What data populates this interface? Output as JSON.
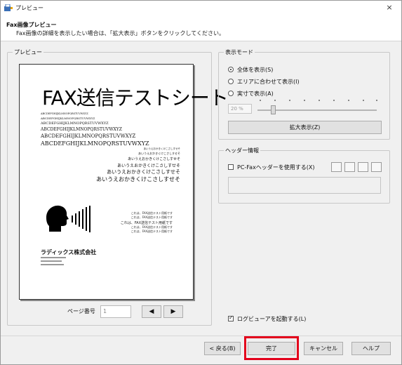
{
  "window": {
    "title": "プレビュー",
    "close_glyph": "×"
  },
  "header": {
    "title": "Fax画像プレビュー",
    "description": "Fax画像の詳細を表示したい場合は、「拡大表示」ボタンをクリックしてください。"
  },
  "preview": {
    "group_label": "プレビュー",
    "page_label": "ページ番号",
    "page_value": "1",
    "prev_glyph": "◀",
    "next_glyph": "▶",
    "document": {
      "title": "FAX送信テストシート",
      "alpha_lines": [
        "ABCDEFGHIJKLMNOPQRSTUVWXYZ",
        "ABCDEFGHIJKLMNOPQRSTUVWXYZ",
        "ABCDEFGHIJKLMNOPQRSTUVWXYZ",
        "ABCDEFGHIJKLMNOPQRSTUVWXYZ",
        "ABCDEFGHIJKLMNOPQRSTUVWXYZ",
        "ABCDEFGHIJKLMNOPQRSTUVWXYZ"
      ],
      "kana_lines": [
        "あいうえおかきくけこさしすせそ",
        "あいうえおかきくけこさしすせそ",
        "あいうえおかきくけこさしすせそ",
        "あいうえおかきくけこさしすせそ",
        "あいうえおかきくけこさしすせそ",
        "あいうえおかきくけこさしすせそ"
      ],
      "messages": [
        "これは、FAX送信テスト用紙です",
        "これは、FAX送信テスト用紙です",
        "これは、FAX送信テスト用紙です",
        "これは、FAX送信テスト用紙です",
        "これは、FAX送信テスト用紙です"
      ],
      "company": "ラディックス株式会社"
    }
  },
  "display_mode": {
    "group_label": "表示モード",
    "options": [
      "全体を表示(S)",
      "エリアに合わせて表示(I)",
      "実寸で表示(A)"
    ],
    "selected_index": 0,
    "zoom_value": "20 %",
    "zoom_level_percent": 20,
    "zoom_button": "拡大表示(Z)"
  },
  "header_info": {
    "group_label": "ヘッダー情報",
    "checkbox_label": "PC-Faxヘッダーを使用する(X)",
    "checked": false
  },
  "options": {
    "log_viewer_label": "ログビューアを起動する(L)",
    "log_viewer_checked": true
  },
  "footer": {
    "back": "< 戻る(B)",
    "finish": "完了",
    "cancel": "キャンセル",
    "help": "ヘルプ"
  }
}
